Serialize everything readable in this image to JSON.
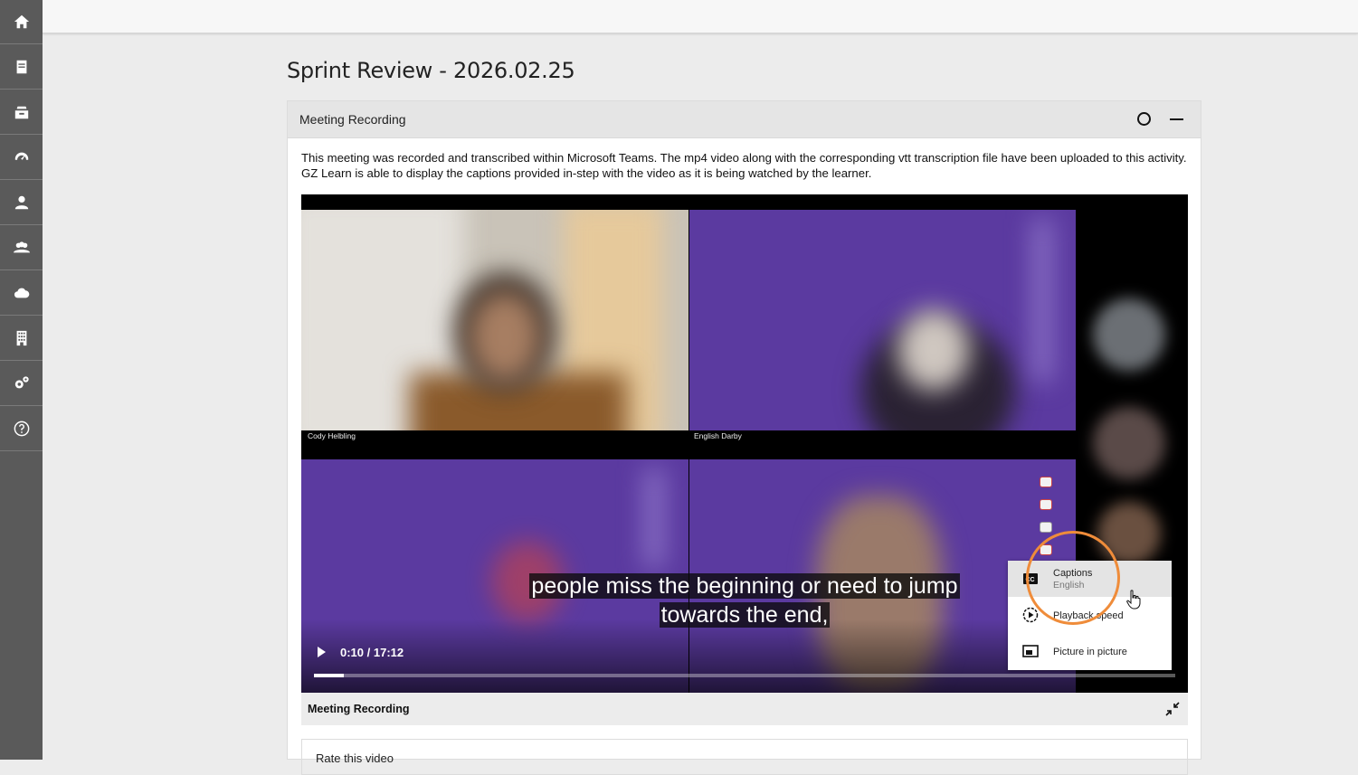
{
  "sidebar": {
    "items": [
      {
        "icon": "home-icon"
      },
      {
        "icon": "book-icon"
      },
      {
        "icon": "inbox-icon"
      },
      {
        "icon": "speedometer-icon"
      },
      {
        "icon": "user-icon"
      },
      {
        "icon": "users-icon"
      },
      {
        "icon": "cloud-icon"
      },
      {
        "icon": "building-icon"
      },
      {
        "icon": "gears-icon"
      },
      {
        "icon": "help-icon"
      }
    ]
  },
  "page": {
    "title": "Sprint Review - 2026.02.25"
  },
  "panel": {
    "title": "Meeting Recording",
    "description": "This meeting was recorded and transcribed within Microsoft Teams. The mp4 video along with the corresponding vtt transcription file have been uploaded to this activity. GZ Learn is able to display the captions provided in-step with the video as it is being watched by the learner."
  },
  "video": {
    "participants": [
      "Cody Helbling",
      "English Darby"
    ],
    "caption_line1": "people miss the beginning or need to jump",
    "caption_line2": "towards the end,",
    "time": "0:10 / 17:12",
    "progress_fraction": 0.035,
    "menu": {
      "captions_label": "Captions",
      "captions_value": "English",
      "speed_label": "Playback speed",
      "pip_label": "Picture in picture"
    },
    "footer_title": "Meeting Recording"
  },
  "rating": {
    "label": "Rate this video"
  },
  "colors": {
    "sidebar": "#5a5a5a",
    "teams_purple": "#5b3aa0",
    "highlight": "#ef8c3a"
  }
}
